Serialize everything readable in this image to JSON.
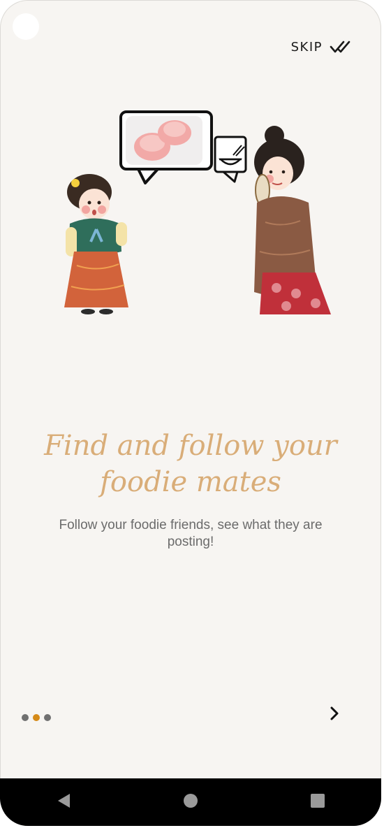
{
  "header": {
    "skip_label": "SKIP",
    "skip_icon": "double-check-icon"
  },
  "onboarding": {
    "title": "Find and follow your foodie mates",
    "subtitle": "Follow your foodie friends, see what they are posting!",
    "page_index": 2,
    "page_count": 3,
    "next_icon": "chevron-right-icon"
  },
  "colors": {
    "background": "#f7f5f2",
    "title": "#d9ad78",
    "subtitle": "#6b6b6b",
    "dot_active": "#d58a18",
    "dot_inactive": "#707070",
    "nav_bar": "#000000"
  },
  "system_nav": {
    "back_icon": "triangle-back-icon",
    "home_icon": "circle-home-icon",
    "recents_icon": "square-recents-icon"
  }
}
